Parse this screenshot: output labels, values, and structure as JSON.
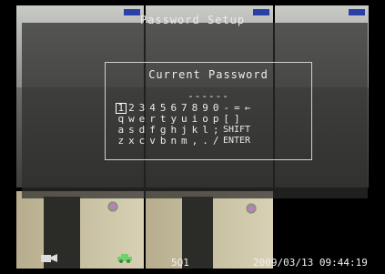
{
  "dialog": {
    "title": "Password Setup",
    "field_label": "Current Password",
    "password_mask": "------",
    "keyboard": {
      "rows": [
        [
          "1",
          "2",
          "3",
          "4",
          "5",
          "6",
          "7",
          "8",
          "9",
          "0",
          "-",
          "=",
          "←"
        ],
        [
          "q",
          "w",
          "e",
          "r",
          "t",
          "y",
          "u",
          "i",
          "o",
          "p",
          "[",
          "]"
        ],
        [
          "a",
          "s",
          "d",
          "f",
          "g",
          "h",
          "j",
          "k",
          "l",
          ";"
        ],
        [
          "z",
          "x",
          "c",
          "v",
          "b",
          "n",
          "m",
          ",",
          ".",
          "/"
        ]
      ],
      "shift_label": "SHIFT",
      "enter_label": "ENTER",
      "selected_key": "1"
    }
  },
  "status": {
    "channel": "5Q1",
    "datetime": "2009/03/13 09:44:19"
  },
  "icons": {
    "left": "camera-icon",
    "middle": "car-icon"
  }
}
